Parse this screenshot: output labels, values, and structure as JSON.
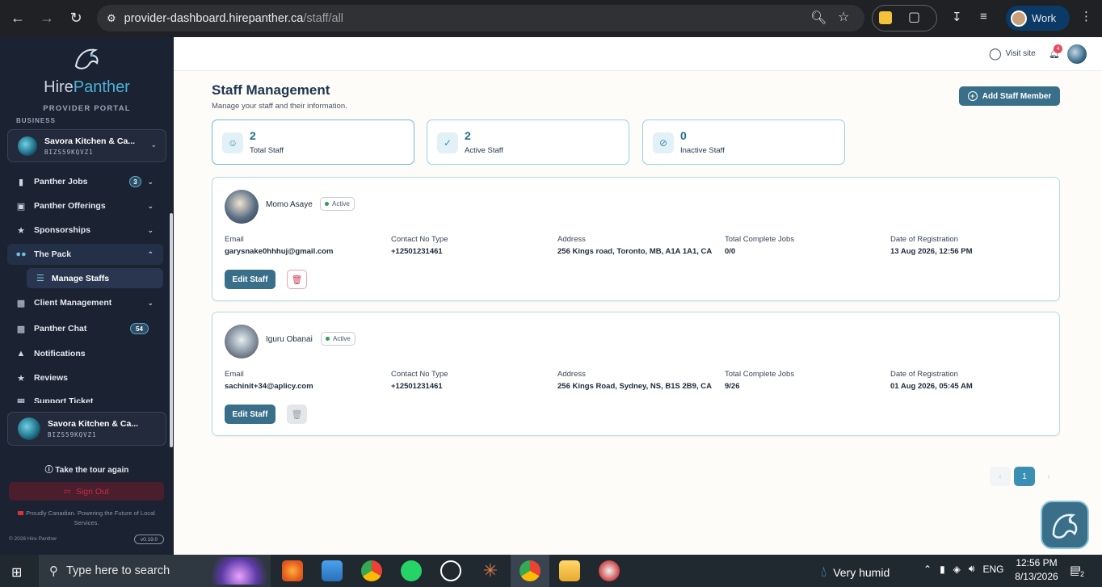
{
  "browser": {
    "url_host": "provider-dashboard.hirepanther.ca",
    "url_path": "/staff/all",
    "profile_label": "Work"
  },
  "sidebar": {
    "brand_prefix": "Hire",
    "brand_suffix": "Panther",
    "portal_label": "PROVIDER PORTAL",
    "section_label": "BUSINESS",
    "business": {
      "name": "Savora Kitchen & Ca...",
      "code": "BIZS59KQVZ1"
    },
    "nav": [
      {
        "label": "Panther Jobs",
        "icon": "bookmark-icon",
        "count": "3",
        "has_chevron": true
      },
      {
        "label": "Panther Offerings",
        "icon": "bag-icon",
        "has_chevron": true
      },
      {
        "label": "Sponsorships",
        "icon": "star-icon",
        "has_chevron": true
      },
      {
        "label": "The Pack",
        "icon": "users-icon",
        "has_chevron": true,
        "expanded": true
      },
      {
        "label": "Manage Staffs",
        "icon": "layers-icon",
        "sub": true
      },
      {
        "label": "Client Management",
        "icon": "contact-icon",
        "has_chevron": true
      },
      {
        "label": "Panther Chat",
        "icon": "chat-icon",
        "count": "54"
      },
      {
        "label": "Notifications",
        "icon": "bell-icon"
      },
      {
        "label": "Reviews",
        "icon": "star-icon"
      },
      {
        "label": "Support Ticket",
        "icon": "ticket-icon"
      }
    ],
    "bottom_business": {
      "name": "Savora Kitchen & Ca...",
      "code": "BIZS59KQVZ1"
    },
    "tour_label": "Take the tour again",
    "signout_label": "Sign Out",
    "footer_note": "Proudly Canadian. Powering the Future of Local Services.",
    "copyright": "© 2026 Hire Panther",
    "version": "v0.19.0"
  },
  "topbar": {
    "visit_label": "Visit site",
    "notification_count": "4"
  },
  "page": {
    "title": "Staff Management",
    "subtitle": "Manage your staff and their information.",
    "add_button": "Add Staff Member"
  },
  "stats": [
    {
      "value": "2",
      "label": "Total Staff",
      "icon": "users-icon"
    },
    {
      "value": "2",
      "label": "Active Staff",
      "icon": "check-circle-icon"
    },
    {
      "value": "0",
      "label": "Inactive Staff",
      "icon": "slash-circle-icon"
    }
  ],
  "field_labels": {
    "email": "Email",
    "contact": "Contact No Type",
    "address": "Address",
    "jobs": "Total Complete Jobs",
    "date": "Date of Registration"
  },
  "staff": [
    {
      "name": "Momo Asaye",
      "status": "Active",
      "email": "garysnake0hhhuj@gmail.com",
      "contact": "+12501231461",
      "address": "256 Kings road, Toronto, MB, A1A 1A1, CA",
      "jobs": "0/0",
      "date": "13 Aug 2026, 12:56 PM",
      "edit_label": "Edit Staff",
      "delete_enabled": true
    },
    {
      "name": "Iguru Obanai",
      "status": "Active",
      "email": "sachinit+34@aplicy.com",
      "contact": "+12501231461",
      "address": "256 Kings Road, Sydney, NS, B1S 2B9, CA",
      "jobs": "9/26",
      "date": "01 Aug 2026, 05:45 AM",
      "edit_label": "Edit Staff",
      "delete_enabled": false
    }
  ],
  "pagination": {
    "current": "1"
  },
  "taskbar": {
    "search_placeholder": "Type here to search",
    "weather": "Very humid",
    "lang": "ENG",
    "time": "12:56 PM",
    "date": "8/13/2026",
    "notif_count": "2"
  },
  "colors": {
    "accent": "#3a6f8a",
    "sidebar_bg": "#1b2232",
    "active_dot": "#2e9d57",
    "delete_red": "#d2405c"
  }
}
